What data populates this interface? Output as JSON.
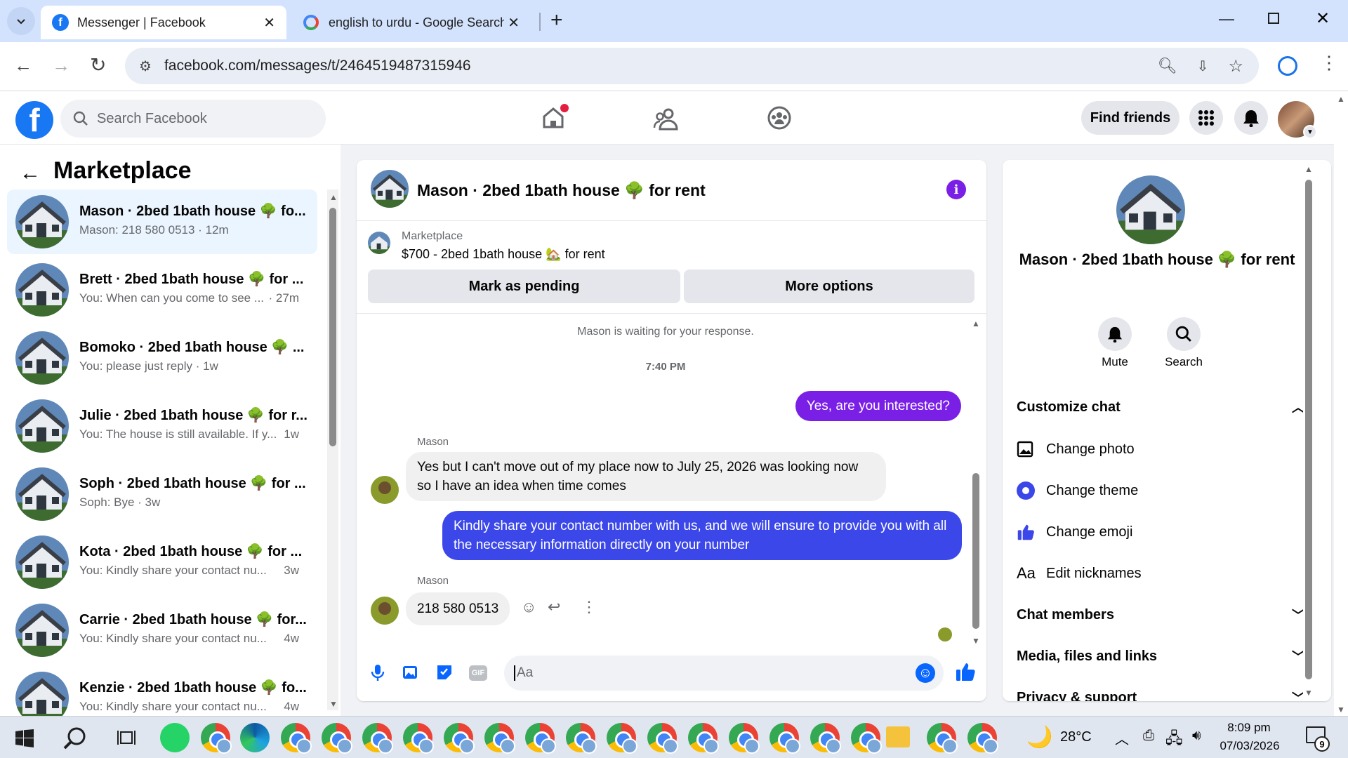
{
  "browser": {
    "tabs": [
      {
        "title": "Messenger | Facebook",
        "active": true
      },
      {
        "title": "english to urdu - Google Search",
        "active": false
      }
    ],
    "new_tab_icon": "plus-icon",
    "url": "facebook.com/messages/t/2464519487315946"
  },
  "fb": {
    "search_placeholder": "Search Facebook",
    "find_friends": "Find friends"
  },
  "left": {
    "title": "Marketplace",
    "conversations": [
      {
        "name": "Mason · 2bed 1bath house 🌳 fo...",
        "preview": "Mason: 218 580 0513 · 12m",
        "time": "",
        "selected": true
      },
      {
        "name": "Brett · 2bed 1bath house 🌳 for ...",
        "preview": "You: When can you come to see ...",
        "time": "· 27m"
      },
      {
        "name": "Bomoko · 2bed 1bath house 🌳 ...",
        "preview": "You: please just reply · 1w",
        "time": ""
      },
      {
        "name": "Julie · 2bed 1bath house 🌳 for r...",
        "preview": "You: The house is still available. If y...",
        "time": "1w"
      },
      {
        "name": "Soph · 2bed 1bath house 🌳 for ...",
        "preview": "Soph: Bye · 3w",
        "time": ""
      },
      {
        "name": "Kota · 2bed 1bath house 🌳 for ...",
        "preview": "You: Kindly share your contact nu...",
        "time": "3w"
      },
      {
        "name": "Carrie · 2bed 1bath house 🌳 for...",
        "preview": "You: Kindly share your contact nu...",
        "time": "4w"
      },
      {
        "name": "Kenzie · 2bed 1bath house 🌳 fo...",
        "preview": "You: Kindly share your contact nu...",
        "time": "4w"
      }
    ]
  },
  "chat": {
    "title": "Mason · 2bed 1bath house 🌳 for rent",
    "listing_label": "Marketplace",
    "listing_title": "$700 - 2bed 1bath house 🏡 for rent",
    "mark_pending": "Mark as pending",
    "more_options": "More options",
    "waiting": "Mason is waiting for your response.",
    "timestamp": "7:40 PM",
    "msg_out_1": "Yes, are you interested?",
    "sender_1": "Mason",
    "msg_in_1": "Yes but I can't  move out of my place  now to July 25, 2026 was looking now so I have an idea when time comes",
    "msg_out_2": "Kindly share your contact number with us, and we will ensure to provide you with all the necessary information directly on your number",
    "sender_2": "Mason",
    "msg_in_2": "218 580 0513",
    "composer_placeholder": "Aa",
    "colors": {
      "purple": "#7a1fe6",
      "blue": "#3b47e8"
    }
  },
  "info": {
    "name": "Mason · 2bed 1bath house 🌳 for rent",
    "mute": "Mute",
    "search": "Search",
    "customize": "Customize chat",
    "change_photo": "Change photo",
    "change_theme": "Change theme",
    "change_emoji": "Change emoji",
    "edit_nicknames": "Edit nicknames",
    "nick_icon": "Aa",
    "chat_members": "Chat members",
    "media": "Media, files and links",
    "privacy": "Privacy & support"
  },
  "taskbar": {
    "temp": "28°C",
    "time": "8:09 pm",
    "date": "07/03/2026",
    "notif_count": "9"
  }
}
